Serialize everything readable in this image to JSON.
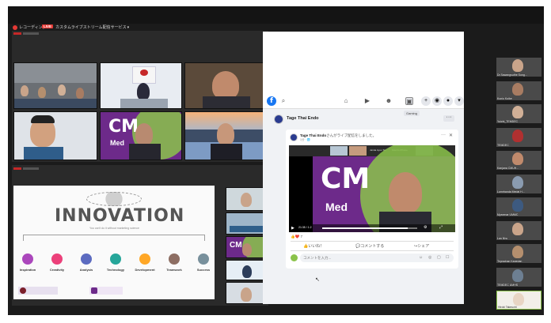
{
  "zoom": {
    "recording_label": "レコーディング",
    "live_badge": "LIVE",
    "stream_label": "カスタムライブストリーム配信サービス",
    "chevron": "▾"
  },
  "cme_text": "CM",
  "cme_sub": "Med",
  "slide": {
    "title": "INNOVATION",
    "subtitle": "You can't do it without marketing science",
    "steps": [
      "Inspiration",
      "Creativity",
      "Analysis",
      "Technology",
      "Development",
      "Teamwork",
      "Success"
    ],
    "step_colors": [
      "#9c27b0",
      "#e91e63",
      "#3f51b5",
      "#009688",
      "#ff9800",
      "#795548",
      "#607d8b"
    ]
  },
  "facebook": {
    "logo": "f",
    "tooltip": "Gaming",
    "page_name": "Tage Thai Endo",
    "post_author": "Tage Thai Endo",
    "post_text": "さんがライブ配信をしました。",
    "post_time": "1分 · 🌐",
    "video_time": "21:35 / 1:2",
    "video_cme": "CM",
    "video_sub": "Med",
    "mini_names": [
      "Jarida Ayus Tan",
      "Kavin's iPhone"
    ],
    "reactions_icons": "👍❤️",
    "reactions_count": "7",
    "like_label": "いいね！",
    "comment_label": "コメントする",
    "share_label": "シェア",
    "comment_placeholder": "コメントを入力..."
  },
  "participants": [
    {
      "name": "Dr.Sawangsuthe Song..."
    },
    {
      "name": "Kunio Koike"
    },
    {
      "name": "Yuichi_TEMDEC"
    },
    {
      "name": "TEMDEC"
    },
    {
      "name": "Kanjana CMUH..."
    },
    {
      "name": "Lumrhanda Medal H..."
    },
    {
      "name": "Myanmar UMMC"
    },
    {
      "name": "Lan Nhu"
    },
    {
      "name": "Teprachan Kanedan"
    },
    {
      "name": "TEMDEC UMHS"
    },
    {
      "name": "Hiroki Takeuchi"
    }
  ]
}
